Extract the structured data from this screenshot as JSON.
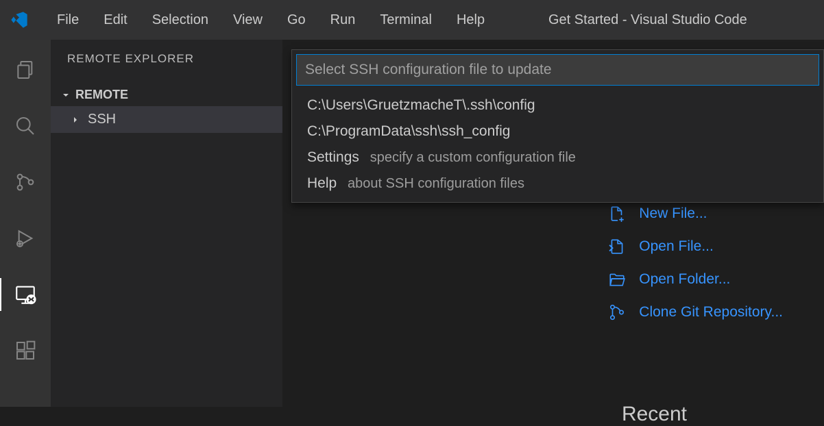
{
  "window": {
    "title": "Get Started - Visual Studio Code"
  },
  "menubar": {
    "items": [
      "File",
      "Edit",
      "Selection",
      "View",
      "Go",
      "Run",
      "Terminal",
      "Help"
    ]
  },
  "sidebar": {
    "title": "REMOTE EXPLORER",
    "section": {
      "label": "REMOTE"
    },
    "tree": {
      "items": [
        {
          "label": "SSH"
        }
      ]
    }
  },
  "quickInput": {
    "placeholder": "Select SSH configuration file to update",
    "options": [
      {
        "label": "C:\\Users\\GruetzmacheT\\.ssh\\config",
        "desc": ""
      },
      {
        "label": "C:\\ProgramData\\ssh\\ssh_config",
        "desc": ""
      },
      {
        "label": "Settings",
        "desc": "specify a custom configuration file"
      },
      {
        "label": "Help",
        "desc": "about SSH configuration files"
      }
    ]
  },
  "start": {
    "actions": [
      {
        "label": "New File...",
        "icon": "new-file"
      },
      {
        "label": "Open File...",
        "icon": "open-file"
      },
      {
        "label": "Open Folder...",
        "icon": "open-folder"
      },
      {
        "label": "Clone Git Repository...",
        "icon": "git-clone"
      }
    ],
    "recentHeader": "Recent"
  },
  "colors": {
    "accent": "#3794ff",
    "inputBorder": "#007fd4"
  }
}
